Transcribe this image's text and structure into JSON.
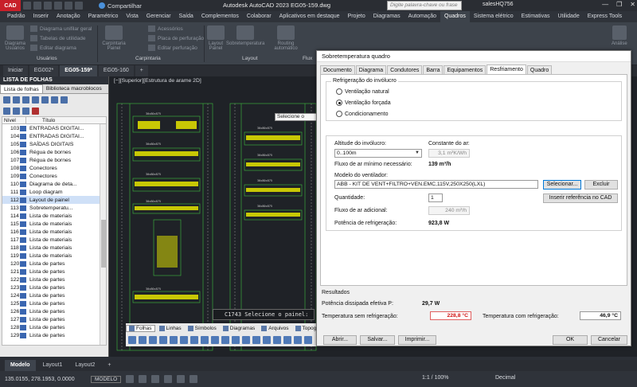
{
  "titlebar": {
    "app_label": "CAD",
    "share": "Compartilhar",
    "window_title": "Autodesk AutoCAD 2023    EG05-159.dwg",
    "search_placeholder": "Digite palavra-chave ou frase",
    "user": "salesHQ756"
  },
  "ribbon_tabs": [
    "Padrão",
    "Inserir",
    "Anotação",
    "Paramétrico",
    "Vista",
    "Gerenciar",
    "Saída",
    "Complementos",
    "Colaborar",
    "Aplicativos em destaque",
    "Projeto",
    "Diagramas",
    "Automação",
    "Quadros",
    "Sistema elétrico",
    "Estimativas",
    "Utilidade",
    "Express Tools"
  ],
  "ribbon_active": "Quadros",
  "ribbon": {
    "diagram_btn": "Diagrama Usuários",
    "items_left": [
      "Diagrama unifilar geral",
      "Tabelas de utilidade",
      "Editar diagrama"
    ],
    "group_users": "Usuários",
    "carpentry_btn": "Carpintaria Painel",
    "items_mid": [
      "Acessórios",
      "Placa de perfuração",
      "Editar perfuração"
    ],
    "group_carpentry": "Carpintaria",
    "layout_btns": [
      "Layout Painel",
      "Sobretemperatura",
      "Routing automático"
    ],
    "group_layout": "Layout",
    "group_flux": "Flux",
    "analysis_btn": "Análise"
  },
  "doc_tabs": [
    "Iniciar",
    "EG002*",
    "EG05-159*",
    "EG05-160",
    "+"
  ],
  "panel": {
    "title": "LISTA DE FOLHAS",
    "tabs": [
      "Lista de folhas",
      "Biblioteca macroblocos"
    ],
    "col_level": "Nível",
    "col_title": "Título",
    "rows": [
      {
        "n": "103",
        "t": "ENTRADAS DIGITAI..."
      },
      {
        "n": "104",
        "t": "ENTRADAS DIGITAI..."
      },
      {
        "n": "105",
        "t": "SAÍDAS DIGITAIS"
      },
      {
        "n": "106",
        "t": "Régua de bornes"
      },
      {
        "n": "107",
        "t": "Régua de bornes"
      },
      {
        "n": "108",
        "t": "Conectores"
      },
      {
        "n": "109",
        "t": "Conectores"
      },
      {
        "n": "110",
        "t": "Diagrama de deta..."
      },
      {
        "n": "111",
        "t": "Loop diagram"
      },
      {
        "n": "112",
        "t": "Layout de painel"
      },
      {
        "n": "113",
        "t": "Sobretemperatu..."
      },
      {
        "n": "114",
        "t": "Lista de materiais"
      },
      {
        "n": "115",
        "t": "Lista de materiais"
      },
      {
        "n": "116",
        "t": "Lista de materiais"
      },
      {
        "n": "117",
        "t": "Lista de materiais"
      },
      {
        "n": "118",
        "t": "Lista de materiais"
      },
      {
        "n": "119",
        "t": "Lista de materiais"
      },
      {
        "n": "120",
        "t": "Lista de partes"
      },
      {
        "n": "121",
        "t": "Lista de partes"
      },
      {
        "n": "122",
        "t": "Lista de partes"
      },
      {
        "n": "123",
        "t": "Lista de partes"
      },
      {
        "n": "124",
        "t": "Lista de partes"
      },
      {
        "n": "125",
        "t": "Lista de partes"
      },
      {
        "n": "126",
        "t": "Lista de partes"
      },
      {
        "n": "127",
        "t": "Lista de partes"
      },
      {
        "n": "128",
        "t": "Lista de partes"
      },
      {
        "n": "129",
        "t": "Lista de partes"
      }
    ],
    "selected": "112"
  },
  "drawing": {
    "viewport_label": "[−][Superior][Estrutura de arame 2D]",
    "tooltip": "Selecione o painel:",
    "command": "C1743 Selecione o painel:",
    "bottom_tabs": [
      "Folhas",
      "Linhas",
      "Símbolos",
      "Diagramas",
      "Arquivos",
      "Topográfico"
    ]
  },
  "dialog": {
    "title": "Sobretemperatura quadro",
    "tabs": [
      "Documento",
      "Diagrama",
      "Condutores",
      "Barra",
      "Equipamentos",
      "Resfriamento",
      "Quadro"
    ],
    "active_tab": "Resfriamento",
    "cooling_legend": "Refrigeração do invólucro",
    "radios": [
      "Ventilação natural",
      "Ventilação forçada",
      "Condicionamento"
    ],
    "radio_selected": "Ventilação forçada",
    "altitude_label": "Altitude do invólucro:",
    "altitude_value": "0..100m",
    "air_const_label": "Constante do ar:",
    "air_const_value": "3,1 m³K/Wh",
    "min_flow_label": "Fluxo de ar mínimo necessário:",
    "min_flow_value": "139 m³/h",
    "fan_model_label": "Modelo do ventilador:",
    "fan_model_value": "ABB - KIT DE VENT+FILTRO+VEN.EMC,115V,250X250(LXL)",
    "select_btn": "Selecionar...",
    "delete_btn": "Excluir",
    "quantity_label": "Quantidade:",
    "quantity_value": "1",
    "insert_cad_btn": "Inserir referência no CAD",
    "extra_flow_label": "Fluxo de ar adicional:",
    "extra_flow_value": "240 m³/h",
    "cooling_power_label": "Potência de refrigeração:",
    "cooling_power_value": "923,8 W",
    "results_label": "Resultados",
    "dissipated_label": "Potência dissipada efetiva P:",
    "dissipated_value": "29,7 W",
    "temp_without_label": "Temperatura sem refrigeração:",
    "temp_without_value": "228,8 °C",
    "temp_with_label": "Temperatura com refrigeração:",
    "temp_with_value": "46,9 °C",
    "buttons": {
      "open": "Abrir...",
      "save": "Salvar...",
      "print": "Imprimir...",
      "ok": "OK",
      "cancel": "Cancelar"
    }
  },
  "layout_tabs": [
    "Modelo",
    "Layout1",
    "Layout2",
    "+"
  ],
  "status": {
    "coords": "135.0155, 278.1953, 0.0000",
    "model": "MODELO",
    "scale": "1:1 / 100%",
    "units": "Decimal"
  },
  "colors": {
    "accent": "#c8202a",
    "drawing_bg": "#1f2227",
    "cad_green": "#3fbf3f",
    "cad_yellow": "#e6e600",
    "alert_red": "#d01010"
  }
}
